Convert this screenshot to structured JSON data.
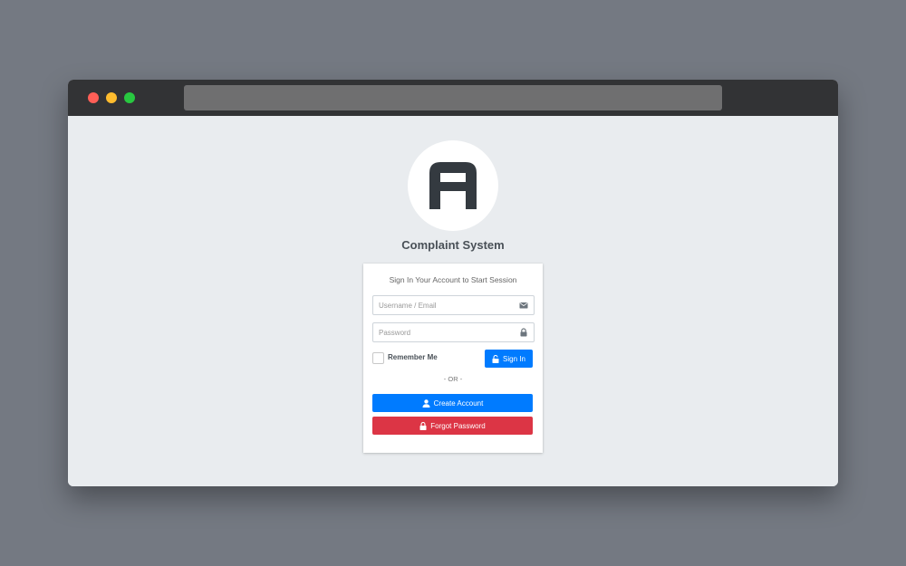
{
  "app": {
    "title": "Complaint System"
  },
  "login": {
    "message": "Sign In Your Account to Start Session",
    "username_placeholder": "Username / Email",
    "password_placeholder": "Password",
    "remember_label": "Remember Me",
    "signin_label": "Sign In",
    "or_text": "- OR -",
    "create_label": "Create Account",
    "forgot_label": "Forgot Password"
  },
  "icons": {
    "logo": "letter-a-logo-icon",
    "username": "envelope-icon",
    "password": "lock-icon",
    "signin": "unlock-icon",
    "create": "user-icon",
    "forgot": "lock-icon"
  },
  "colors": {
    "primary": "#007bff",
    "danger": "#dc3545",
    "background": "#e9ecef",
    "titlebar": "#323335"
  }
}
